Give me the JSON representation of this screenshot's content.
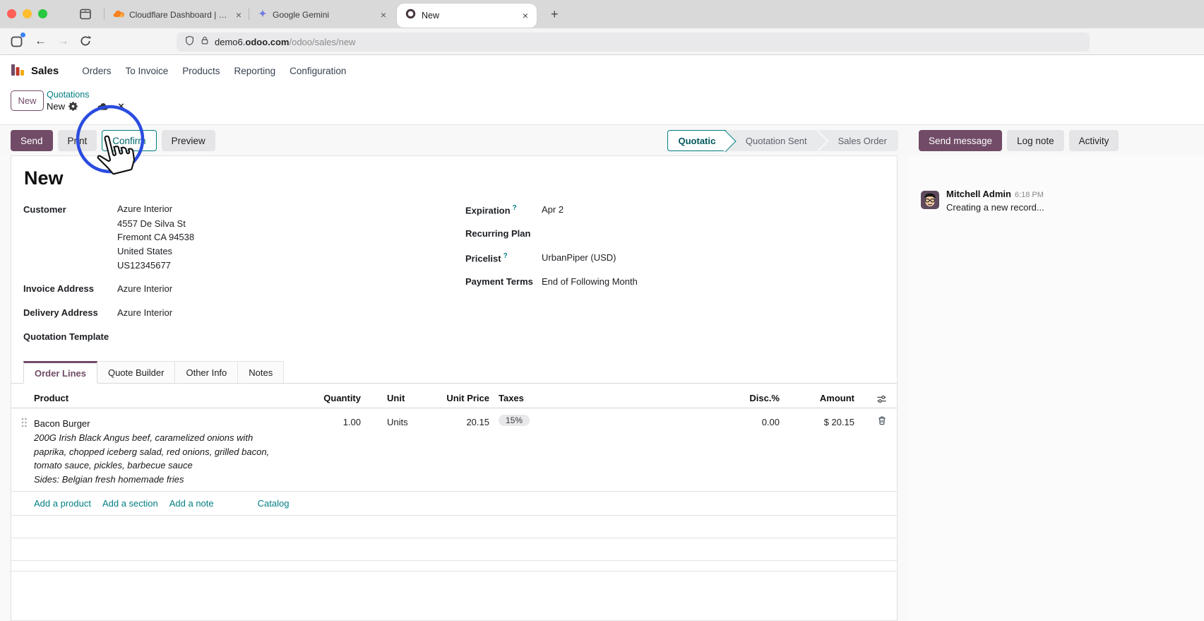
{
  "colors": {
    "odoo_purple": "#714B67",
    "odoo_teal": "#017E84",
    "annotation_blue": "#2B4CE0"
  },
  "browser": {
    "close_glyph": "×",
    "new_tab_glyph": "+",
    "tabs": [
      {
        "title": "Cloudflare Dashboard | Manage"
      },
      {
        "title": "Google Gemini"
      },
      {
        "title": "New"
      }
    ],
    "nav_glyphs": {
      "back": "←",
      "forward": "→"
    },
    "url": {
      "host": "demo6.",
      "domain": "odoo.com",
      "path": "/odoo/sales/new"
    }
  },
  "nav": {
    "app": "Sales",
    "items": [
      "Orders",
      "To Invoice",
      "Products",
      "Reporting",
      "Configuration"
    ]
  },
  "breadcrumb": {
    "new_button": "New",
    "parent": "Quotations",
    "current": "New",
    "discard_glyph": "×"
  },
  "control": {
    "send": "Send",
    "print": "Print",
    "confirm": "Confirm",
    "preview": "Preview",
    "statusbar": [
      "Quotation",
      "Quotation Sent",
      "Sales Order"
    ],
    "chatter_buttons": [
      "Send message",
      "Log note",
      "Activity"
    ]
  },
  "form": {
    "title": "New",
    "customer_label": "Customer",
    "customer_name": "Azure Interior",
    "customer_address": [
      "4557 De Silva St",
      "Fremont CA 94538",
      "United States",
      "US12345677"
    ],
    "invoice_label": "Invoice Address",
    "invoice_value": "Azure Interior",
    "delivery_label": "Delivery Address",
    "delivery_value": "Azure Interior",
    "template_label": "Quotation Template",
    "expiration_label": "Expiration",
    "expiration_help": "?",
    "expiration_value": "Apr 2",
    "recurring_label": "Recurring Plan",
    "pricelist_label": "Pricelist",
    "pricelist_help": "?",
    "pricelist_value": "UrbanPiper (USD)",
    "payment_label": "Payment Terms",
    "payment_value": "End of Following Month"
  },
  "notebook": {
    "tabs": [
      "Order Lines",
      "Quote Builder",
      "Other Info",
      "Notes"
    ]
  },
  "table": {
    "headers": {
      "product": "Product",
      "quantity": "Quantity",
      "unit": "Unit",
      "unit_price": "Unit Price",
      "taxes": "Taxes",
      "disc": "Disc.%",
      "amount": "Amount"
    },
    "row": {
      "product": "Bacon Burger",
      "description": [
        "200G Irish Black Angus beef, caramelized onions with",
        "paprika, chopped iceberg salad, red onions, grilled bacon,",
        "tomato sauce, pickles, barbecue sauce",
        "Sides: Belgian fresh homemade fries"
      ],
      "quantity": "1.00",
      "unit": "Units",
      "unit_price": "20.15",
      "tax": "15%",
      "disc": "0.00",
      "amount": "$ 20.15"
    },
    "links": [
      "Add a product",
      "Add a section",
      "Add a note",
      "Catalog"
    ]
  },
  "chatter": {
    "author": "Mitchell Admin",
    "time": "6:18 PM",
    "message": "Creating a new record..."
  }
}
